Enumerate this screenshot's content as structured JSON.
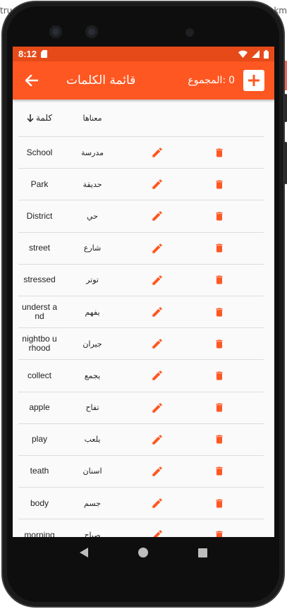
{
  "background": {
    "left_text": "tru",
    "right_text": "km"
  },
  "status_bar": {
    "time": "8:12"
  },
  "app_bar": {
    "title": "قائمة الكلمات",
    "total_label": "المجموع:",
    "total_value": "0"
  },
  "table": {
    "headers": {
      "word": "كلمة",
      "meaning": "معناها"
    },
    "rows": [
      {
        "word": "School",
        "meaning": "مدرسة"
      },
      {
        "word": "Park",
        "meaning": "حديقة"
      },
      {
        "word": "District",
        "meaning": "حي"
      },
      {
        "word": "street",
        "meaning": "شارع"
      },
      {
        "word": "stressed",
        "meaning": "توتر"
      },
      {
        "word": "underst and",
        "meaning": "يفهم"
      },
      {
        "word": "nightbo urhood",
        "meaning": "جيران"
      },
      {
        "word": "collect",
        "meaning": "يجمع"
      },
      {
        "word": "apple",
        "meaning": "تفاح"
      },
      {
        "word": "play",
        "meaning": "يلعب"
      },
      {
        "word": "teath",
        "meaning": "اسنان"
      },
      {
        "word": "body",
        "meaning": "جسم"
      },
      {
        "word": "morning",
        "meaning": "صباح"
      }
    ]
  },
  "colors": {
    "accent": "#ff5722",
    "status": "#e64a19",
    "icon": "#ff5722"
  },
  "icons": {
    "edit": "pencil-icon",
    "delete": "trash-icon",
    "add": "plus-icon",
    "back": "arrow-left-icon",
    "sort": "arrow-down-icon"
  }
}
